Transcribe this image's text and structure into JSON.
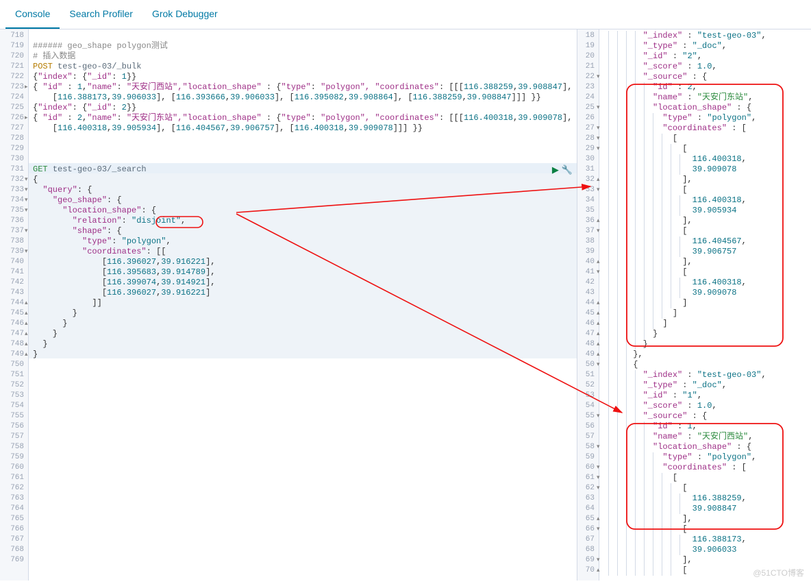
{
  "tabs": [
    {
      "label": "Console",
      "active": true
    },
    {
      "label": "Search Profiler",
      "active": false
    },
    {
      "label": "Grok Debugger",
      "active": false
    }
  ],
  "left_gutter_start": 718,
  "left_gutter_end": 769,
  "left_lines": [
    {
      "n": 718,
      "t": "",
      "fold": ""
    },
    {
      "n": 719,
      "t": "###### geo_shape polygon测试",
      "fold": "",
      "cls": "cmt"
    },
    {
      "n": 720,
      "t": "# 插入数据",
      "fold": "",
      "cls": "cmt"
    },
    {
      "n": 721,
      "t": "POST test-geo-03/_bulk",
      "fold": "",
      "cls": "req1"
    },
    {
      "n": 722,
      "t": "{\"index\": {\"_id\": 1}}",
      "fold": ""
    },
    {
      "n": 723,
      "t": "{ \"id\" : 1,\"name\": \"天安门西站\",\"location_shape\" : {\"type\": \"polygon\", \"coordinates\": [[[116.388259,39.908847],",
      "fold": "▸"
    },
    {
      "n": "",
      "t": "    [116.388173,39.906033], [116.393666,39.906033], [116.395082,39.908864], [116.388259,39.908847]]] }}",
      "fold": ""
    },
    {
      "n": 724,
      "t": "{\"index\": {\"_id\": 2}}",
      "fold": ""
    },
    {
      "n": 725,
      "t": "{ \"id\" : 2,\"name\": \"天安门东站\",\"location_shape\" : {\"type\": \"polygon\", \"coordinates\": [[[116.400318,39.909078],",
      "fold": "▸"
    },
    {
      "n": "",
      "t": "    [116.400318,39.905934], [116.404567,39.906757], [116.400318,39.909078]]] }}",
      "fold": ""
    },
    {
      "n": 726,
      "t": "",
      "fold": ""
    },
    {
      "n": 727,
      "t": "",
      "fold": ""
    },
    {
      "n": 728,
      "t": "",
      "fold": ""
    },
    {
      "n": 729,
      "t": "GET test-geo-03/_search",
      "fold": "",
      "cls": "req2",
      "active": true
    },
    {
      "n": 730,
      "t": "{",
      "fold": "▾",
      "hl": true
    },
    {
      "n": 731,
      "t": "  \"query\": {",
      "fold": "▾",
      "hl": true
    },
    {
      "n": 732,
      "t": "    \"geo_shape\": {",
      "fold": "▾",
      "hl": true
    },
    {
      "n": 733,
      "t": "      \"location_shape\": {",
      "fold": "▾",
      "hl": true
    },
    {
      "n": 734,
      "t": "        \"relation\": \"disjoint\",",
      "fold": "",
      "hl": true,
      "circle": true
    },
    {
      "n": 735,
      "t": "        \"shape\": {",
      "fold": "▾",
      "hl": true
    },
    {
      "n": 736,
      "t": "          \"type\": \"polygon\",",
      "fold": "",
      "hl": true
    },
    {
      "n": 737,
      "t": "          \"coordinates\": [[",
      "fold": "▾",
      "hl": true
    },
    {
      "n": 738,
      "t": "              [116.396027,39.916221],",
      "fold": "",
      "hl": true
    },
    {
      "n": 739,
      "t": "              [116.395683,39.914789],",
      "fold": "",
      "hl": true
    },
    {
      "n": 740,
      "t": "              [116.399074,39.914921],",
      "fold": "",
      "hl": true
    },
    {
      "n": 741,
      "t": "              [116.396027,39.916221]",
      "fold": "",
      "hl": true
    },
    {
      "n": 742,
      "t": "            ]]",
      "fold": "▴",
      "hl": true
    },
    {
      "n": 743,
      "t": "        }",
      "fold": "▴",
      "hl": true
    },
    {
      "n": 744,
      "t": "      }",
      "fold": "▴",
      "hl": true
    },
    {
      "n": 745,
      "t": "    }",
      "fold": "▴",
      "hl": true
    },
    {
      "n": 746,
      "t": "  }",
      "fold": "▴",
      "hl": true
    },
    {
      "n": 747,
      "t": "}",
      "fold": "▴",
      "hl": true
    },
    {
      "n": 748,
      "t": "",
      "fold": ""
    },
    {
      "n": 749,
      "t": "",
      "fold": ""
    },
    {
      "n": 750,
      "t": "",
      "fold": ""
    },
    {
      "n": 751,
      "t": "",
      "fold": ""
    },
    {
      "n": 752,
      "t": "",
      "fold": ""
    },
    {
      "n": 753,
      "t": "",
      "fold": ""
    },
    {
      "n": 754,
      "t": "",
      "fold": ""
    },
    {
      "n": 755,
      "t": "",
      "fold": ""
    },
    {
      "n": 756,
      "t": "",
      "fold": ""
    },
    {
      "n": 757,
      "t": "",
      "fold": ""
    },
    {
      "n": 758,
      "t": "",
      "fold": ""
    },
    {
      "n": 759,
      "t": "",
      "fold": ""
    },
    {
      "n": 760,
      "t": "",
      "fold": ""
    },
    {
      "n": 761,
      "t": "",
      "fold": ""
    },
    {
      "n": 762,
      "t": "",
      "fold": ""
    },
    {
      "n": 763,
      "t": "",
      "fold": ""
    },
    {
      "n": 764,
      "t": "",
      "fold": ""
    },
    {
      "n": 765,
      "t": "",
      "fold": ""
    },
    {
      "n": 766,
      "t": "",
      "fold": ""
    },
    {
      "n": 767,
      "t": "",
      "fold": ""
    },
    {
      "n": 768,
      "t": "",
      "fold": ""
    },
    {
      "n": 769,
      "t": "",
      "fold": ""
    }
  ],
  "right_gutter_start": 18,
  "right_gutter_end": 70,
  "right_lines": [
    {
      "n": 18,
      "t": "        \"_index\" : \"test-geo-03\",",
      "i": 4
    },
    {
      "n": 19,
      "t": "        \"_type\" : \"_doc\",",
      "i": 4
    },
    {
      "n": 20,
      "t": "        \"_id\" : \"2\",",
      "i": 4
    },
    {
      "n": 21,
      "t": "        \"_score\" : 1.0,",
      "i": 4
    },
    {
      "n": 22,
      "t": "        \"_source\" : {",
      "fold": "▾",
      "i": 4
    },
    {
      "n": 23,
      "t": "          \"id\" : 2,",
      "i": 5,
      "box": "top"
    },
    {
      "n": 24,
      "t": "          \"name\" : \"天安门东站\",",
      "name": true,
      "i": 5
    },
    {
      "n": 25,
      "t": "          \"location_shape\" : {",
      "fold": "▾",
      "i": 5
    },
    {
      "n": 26,
      "t": "            \"type\" : \"polygon\",",
      "i": 6
    },
    {
      "n": 27,
      "t": "            \"coordinates\" : [",
      "fold": "▾",
      "i": 6
    },
    {
      "n": 28,
      "t": "              [",
      "fold": "▾",
      "i": 7
    },
    {
      "n": 29,
      "t": "                [",
      "fold": "▾",
      "i": 8
    },
    {
      "n": 30,
      "t": "                  116.400318,",
      "i": 9
    },
    {
      "n": 31,
      "t": "                  39.909078",
      "i": 9
    },
    {
      "n": 32,
      "t": "                ],",
      "fold": "▴",
      "i": 8
    },
    {
      "n": 33,
      "t": "                [",
      "fold": "▾",
      "i": 8
    },
    {
      "n": 34,
      "t": "                  116.400318,",
      "i": 9
    },
    {
      "n": 35,
      "t": "                  39.905934",
      "i": 9
    },
    {
      "n": 36,
      "t": "                ],",
      "fold": "▴",
      "i": 8
    },
    {
      "n": 37,
      "t": "                [",
      "fold": "▾",
      "i": 8
    },
    {
      "n": 38,
      "t": "                  116.404567,",
      "i": 9
    },
    {
      "n": 39,
      "t": "                  39.906757",
      "i": 9
    },
    {
      "n": 40,
      "t": "                ],",
      "fold": "▴",
      "i": 8
    },
    {
      "n": 41,
      "t": "                [",
      "fold": "▾",
      "i": 8
    },
    {
      "n": 42,
      "t": "                  116.400318,",
      "i": 9
    },
    {
      "n": 43,
      "t": "                  39.909078",
      "i": 9
    },
    {
      "n": 44,
      "t": "                ]",
      "fold": "▴",
      "i": 8
    },
    {
      "n": 45,
      "t": "              ]",
      "fold": "▴",
      "i": 7
    },
    {
      "n": 46,
      "t": "            ]",
      "fold": "▴",
      "i": 6
    },
    {
      "n": 47,
      "t": "          }",
      "fold": "▴",
      "i": 5,
      "box": "bottom"
    },
    {
      "n": 48,
      "t": "        }",
      "fold": "▴",
      "i": 4
    },
    {
      "n": 49,
      "t": "      },",
      "fold": "▴",
      "i": 3
    },
    {
      "n": 50,
      "t": "      {",
      "fold": "▾",
      "i": 3
    },
    {
      "n": 51,
      "t": "        \"_index\" : \"test-geo-03\",",
      "i": 4
    },
    {
      "n": 52,
      "t": "        \"_type\" : \"_doc\",",
      "i": 4
    },
    {
      "n": 53,
      "t": "        \"_id\" : \"1\",",
      "i": 4
    },
    {
      "n": 54,
      "t": "        \"_score\" : 1.0,",
      "i": 4
    },
    {
      "n": 55,
      "t": "        \"_source\" : {",
      "fold": "▾",
      "i": 4
    },
    {
      "n": 56,
      "t": "          \"id\" : 1,",
      "i": 5,
      "box": "top2"
    },
    {
      "n": 57,
      "t": "          \"name\" : \"天安门西站\",",
      "name": true,
      "i": 5
    },
    {
      "n": 58,
      "t": "          \"location_shape\" : {",
      "fold": "▾",
      "i": 5
    },
    {
      "n": 59,
      "t": "            \"type\" : \"polygon\",",
      "i": 6
    },
    {
      "n": 60,
      "t": "            \"coordinates\" : [",
      "fold": "▾",
      "i": 6
    },
    {
      "n": 61,
      "t": "              [",
      "fold": "▾",
      "i": 7
    },
    {
      "n": 62,
      "t": "                [",
      "fold": "▾",
      "i": 8
    },
    {
      "n": 63,
      "t": "                  116.388259,",
      "i": 9
    },
    {
      "n": 64,
      "t": "                  39.908847",
      "i": 9
    },
    {
      "n": 65,
      "t": "                ],",
      "fold": "▴",
      "i": 8,
      "box": "bottom2"
    },
    {
      "n": 66,
      "t": "                [",
      "fold": "▾",
      "i": 8
    },
    {
      "n": 67,
      "t": "                  116.388173,",
      "i": 9
    },
    {
      "n": 68,
      "t": "                  39.906033",
      "i": 9
    },
    {
      "n": 69,
      "t": "                ],",
      "fold": "▾",
      "i": 8
    },
    {
      "n": 70,
      "t": "                [",
      "fold": "▴",
      "i": 8
    }
  ],
  "watermark": "@51CTO博客",
  "actions": {
    "play": "▶",
    "wrench": "🔧"
  }
}
